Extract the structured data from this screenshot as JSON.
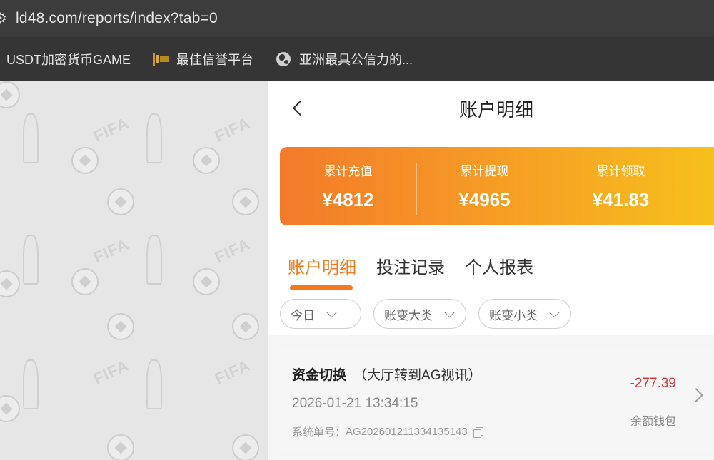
{
  "browser": {
    "url": "ld48.com/reports/index?tab=0",
    "bookmarks": [
      {
        "label": "USDT加密货币GAME",
        "icon": "none"
      },
      {
        "label": "最佳信誉平台",
        "icon": "site-logo-icon"
      },
      {
        "label": "亚洲最具公信力的...",
        "icon": "globe-icon"
      }
    ]
  },
  "page": {
    "title": "账户明细",
    "summary": [
      {
        "label": "累计充值",
        "value": "¥4812"
      },
      {
        "label": "累计提现",
        "value": "¥4965"
      },
      {
        "label": "累计领取",
        "value": "¥41.83"
      }
    ],
    "tabs": [
      {
        "label": "账户明细",
        "active": true
      },
      {
        "label": "投注记录",
        "active": false
      },
      {
        "label": "个人报表",
        "active": false
      }
    ],
    "filters": [
      {
        "label": "今日"
      },
      {
        "label": "账变大类"
      },
      {
        "label": "账变小类"
      }
    ],
    "records": [
      {
        "title": "资金切换",
        "subtitle": "（大厅转到AG视讯）",
        "time": "2026-01-21 13:34:15",
        "order_label": "系统单号：",
        "order_no": "AG202601211334135143",
        "amount": "-277.39",
        "wallet": "余额钱包"
      }
    ],
    "colors": {
      "accent": "#f47a20",
      "negative": "#d9363e",
      "gradient_start": "#f37a2a",
      "gradient_end": "#f6c21b"
    },
    "decoration_text": "FIFA"
  }
}
